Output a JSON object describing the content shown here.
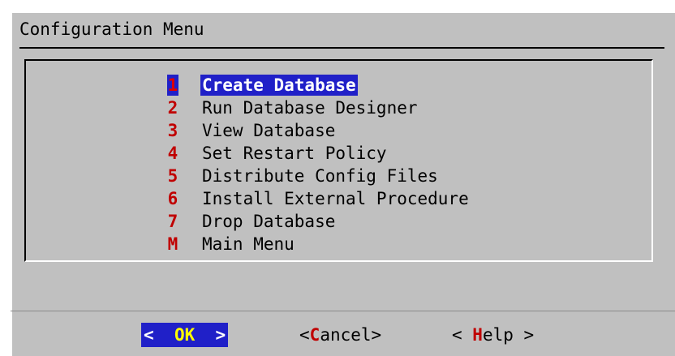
{
  "dialog": {
    "title": "Configuration Menu"
  },
  "menu": {
    "selected_index": 0,
    "items": [
      {
        "key": "1",
        "label": "Create Database"
      },
      {
        "key": "2",
        "label": "Run Database Designer"
      },
      {
        "key": "3",
        "label": "View Database"
      },
      {
        "key": "4",
        "label": "Set Restart Policy"
      },
      {
        "key": "5",
        "label": "Distribute Config Files"
      },
      {
        "key": "6",
        "label": "Install External Procedure"
      },
      {
        "key": "7",
        "label": "Drop Database"
      },
      {
        "key": "M",
        "label": "Main Menu"
      }
    ]
  },
  "buttons": {
    "ok": {
      "left": "<  ",
      "hotkey": "OK",
      "right": "  >"
    },
    "cancel": {
      "left": "<",
      "hotkey": "C",
      "right": "ancel>"
    },
    "help": {
      "left": "< ",
      "hotkey": "H",
      "right": "elp >"
    }
  },
  "colors": {
    "dialog_bg": "#c0c0c0",
    "highlight": "#2020c8",
    "hotkey": "#c00000",
    "selected_hotkey": "#ffff00"
  }
}
